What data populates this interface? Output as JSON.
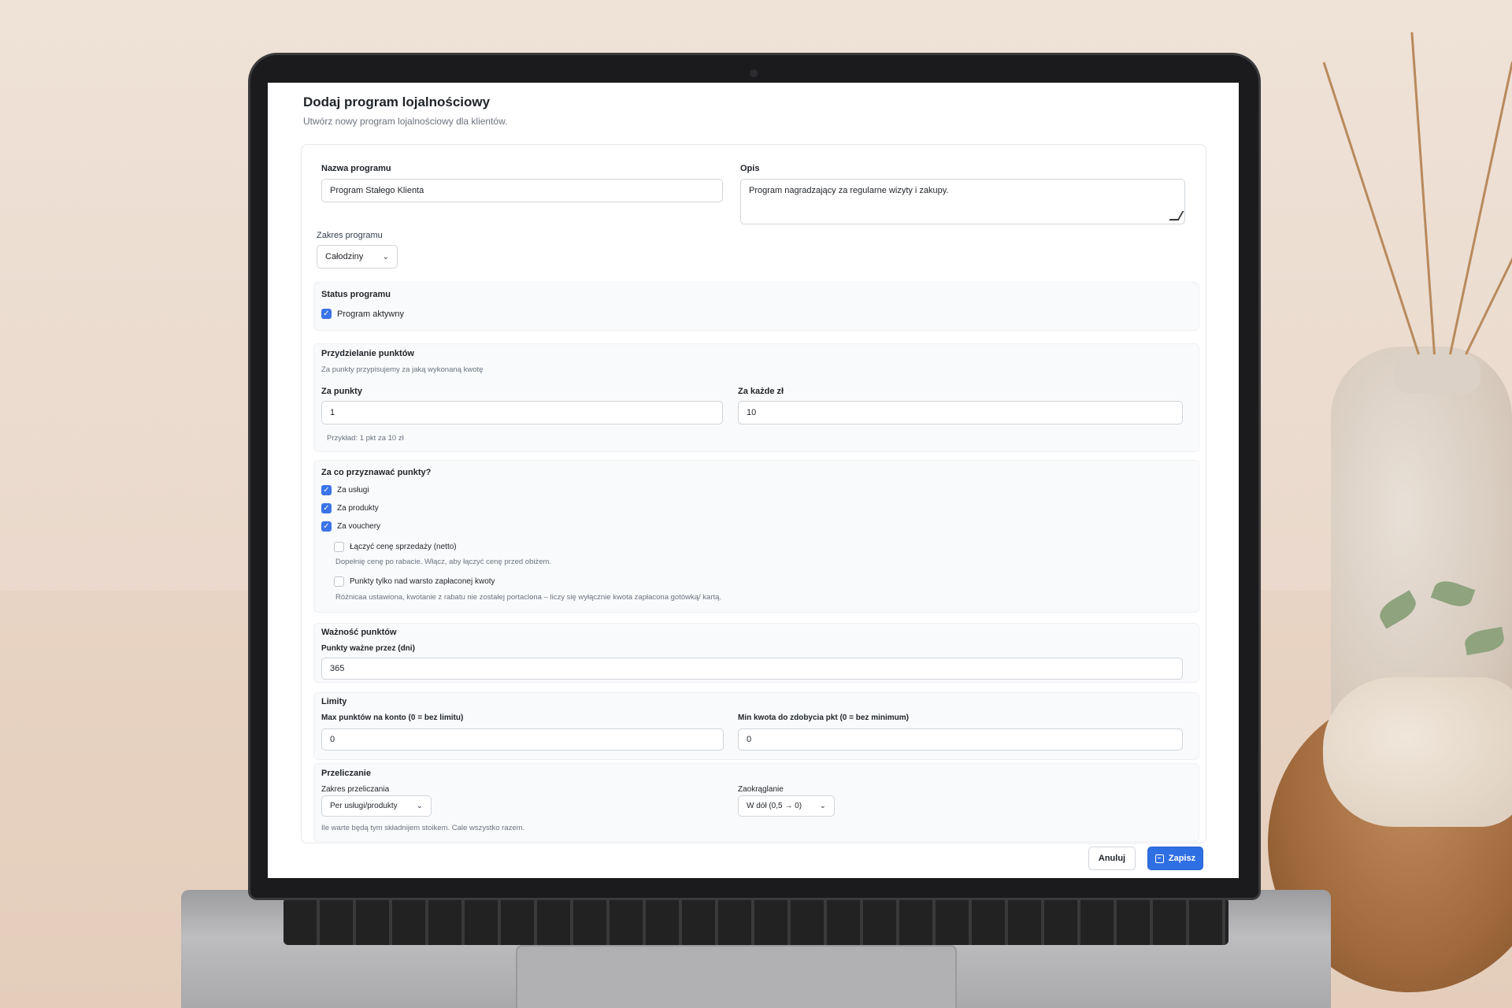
{
  "page": {
    "title": "Dodaj program lojalnościowy",
    "subtitle": "Utwórz nowy program lojalnościowy dla klientów."
  },
  "basic": {
    "name_label": "Nazwa programu",
    "name_value": "Program Stałego Klienta",
    "desc_label": "Opis",
    "desc_value": "Program nagradzający za regularne wizyty i zakupy.",
    "scope_label": "Zakres programu",
    "scope_value": "Całodziny"
  },
  "status": {
    "title": "Status programu",
    "active_label": "Program aktywny",
    "active_checked": true
  },
  "points": {
    "title": "Przydzielanie punktów",
    "hint": "Za punkty przypisujemy za jaką wykonaną kwotę",
    "points_label": "Za punkty",
    "points_value": "1",
    "per_label": "Za każde zł",
    "per_value": "10",
    "example": "Przykład: 1 pkt za 10 zł"
  },
  "earn": {
    "title": "Za co przyznawać punkty?",
    "services_label": "Za usługi",
    "products_label": "Za produkty",
    "vouchers_label": "Za vouchery",
    "net_label": "Łączyć cenę sprzedaży (netto)",
    "net_hint": "Dopełnię cenę po rabacie. Włącz, aby łączyć cenę przed obiżem.",
    "paid_label": "Punkty tylko nad warsto zapłaconej kwoty",
    "paid_hint": "Różnicaa ustawiona, kwotanie z rabatu nie zostałej portaclona – liczy się wyłącznie kwota zapłacona gotówką/ kartą."
  },
  "validity": {
    "title": "Ważność punktów",
    "days_label": "Punkty ważne przez (dni)",
    "days_value": "365"
  },
  "limits": {
    "title": "Limity",
    "max_label": "Max punktów na konto (0 = bez limitu)",
    "max_value": "0",
    "min_label": "Min kwota do zdobycia pkt (0 = bez minimum)",
    "min_value": "0"
  },
  "calc": {
    "title": "Przeliczanie",
    "scope_label": "Zakres przeliczania",
    "scope_value": "Per usługi/produkty",
    "round_label": "Zaokrąglanie",
    "round_value": "W dół (0,5 → 0)",
    "hint": "Ile warte będą tym składnijem stoikem. Cale wszystko razem."
  },
  "actions": {
    "cancel": "Anuluj",
    "save": "Zapisz"
  },
  "colors": {
    "accent": "#2f6fe4",
    "checkbox": "#3b74e8"
  }
}
